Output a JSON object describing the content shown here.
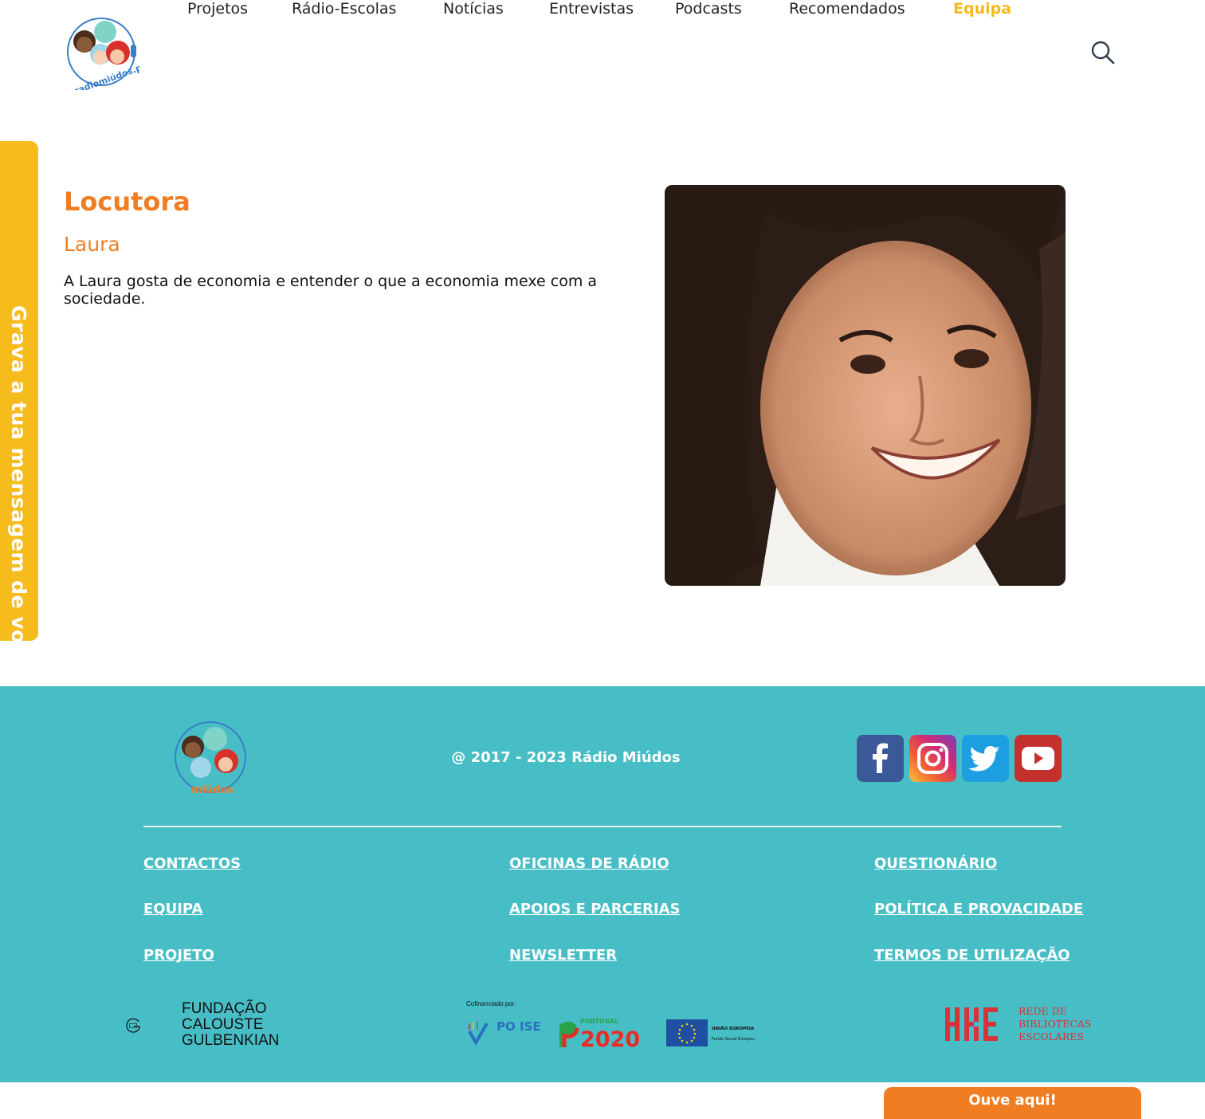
{
  "header": {
    "logo_text": "radiomiúdos.pt",
    "nav": [
      {
        "label": "Projetos"
      },
      {
        "label": "Rádio-Escolas"
      },
      {
        "label": "Notícias"
      },
      {
        "label": "Entrevistas"
      },
      {
        "label": "Podcasts"
      },
      {
        "label": "Recomendados"
      },
      {
        "label": "Equipa",
        "active": true
      }
    ],
    "search_icon": "search-icon"
  },
  "side_tab": {
    "label": "Grava a tua mensagem de voz aqui!",
    "icon": "microphone-icon",
    "color": "#f5bc1c"
  },
  "profile": {
    "role": "Locutora",
    "name": "Laura",
    "bio": "A Laura gosta de economia e entender o que a economia mexe com a sociedade.",
    "accent_color": "#f07d22"
  },
  "footer": {
    "background": "#47bec6",
    "logo_text": "miúdos",
    "copyright": "@ 2017 - 2023 Rádio Miúdos",
    "social": [
      {
        "icon": "facebook-icon"
      },
      {
        "icon": "instagram-icon"
      },
      {
        "icon": "twitter-icon"
      },
      {
        "icon": "youtube-icon"
      }
    ],
    "links": {
      "col1": [
        "CONTACTOS",
        "EQUIPA",
        "PROJETO"
      ],
      "col2": [
        "OFICINAS DE RÁDIO",
        "APOIOS E PARCERIAS",
        "NEWSLETTER"
      ],
      "col3": [
        "QUESTIONÁRIO",
        "POLÍTICA E PROVACIDADE",
        "TERMOS DE UTILIZAÇÃO"
      ]
    },
    "partners": {
      "gulbenkian": [
        "FUNDAÇÃO",
        "CALOUSTE",
        "GULBENKIAN"
      ],
      "cofin_label": "Cofinanciado por:",
      "poise": "PO ISE",
      "portugal_label": "PORTUGAL",
      "portugal_year": "2020",
      "eu_label": "UNIÃO EUROPEIA",
      "eu_sub": "Fundo Social Europeu",
      "rbe": [
        "REDE DE",
        "BIBLIOTECAS",
        "ESCOLARES"
      ]
    }
  },
  "listen_button": {
    "label": "Ouve aqui!"
  }
}
